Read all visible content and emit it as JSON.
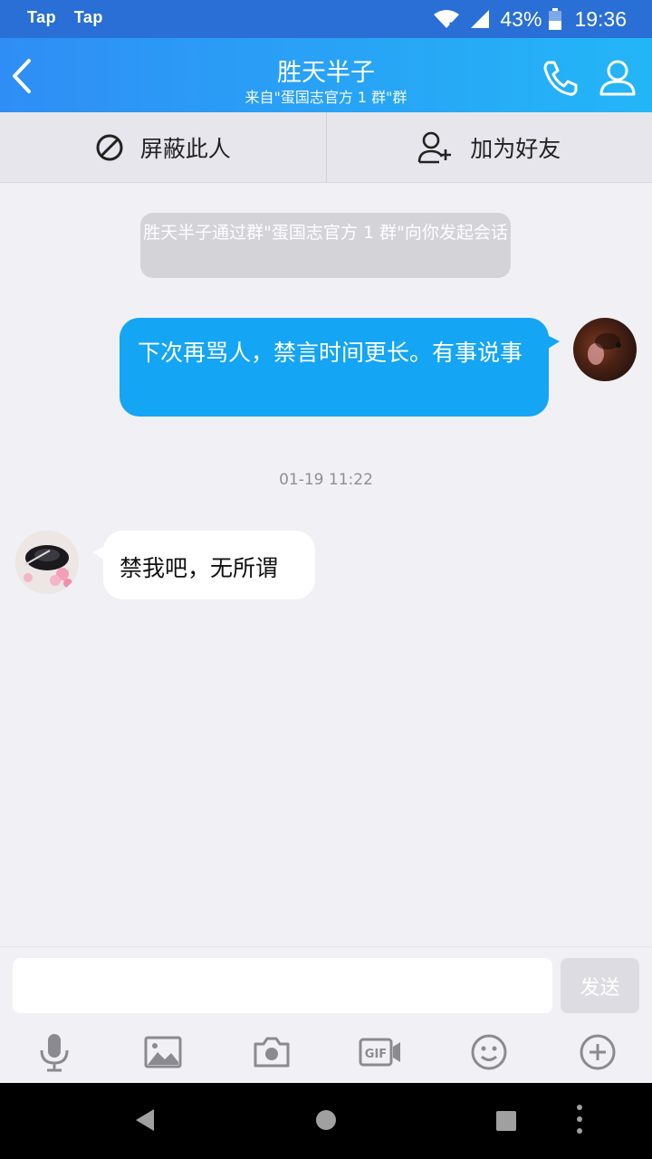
{
  "status_bar": {
    "app_icons": [
      "Tap",
      "Tap"
    ],
    "battery": "43%",
    "time": "19:36"
  },
  "header": {
    "title": "胜天半子",
    "subtitle": "来自\"蛋国志官方 1 群\"群"
  },
  "actions": {
    "block_label": "屏蔽此人",
    "add_friend_label": "加为好友"
  },
  "messages": {
    "system": "胜天半子通过群\"蛋国志官方 1 群\"向你发起会话",
    "outgoing_text": "下次再骂人，禁言时间更长。有事说事",
    "timestamp": "01-19 11:22",
    "incoming_text": "禁我吧，无所谓"
  },
  "composer": {
    "input_value": "",
    "send_label": "发送",
    "tools": [
      "microphone-icon",
      "image-icon",
      "camera-icon",
      "gif-icon",
      "emoji-icon",
      "plus-icon"
    ]
  },
  "colors": {
    "status_bar": "#2a6fd6",
    "header_start": "#2f8ef5",
    "header_end": "#23b6f7",
    "outgoing_bubble": "#14a5f4",
    "background": "#f0f0f5"
  }
}
